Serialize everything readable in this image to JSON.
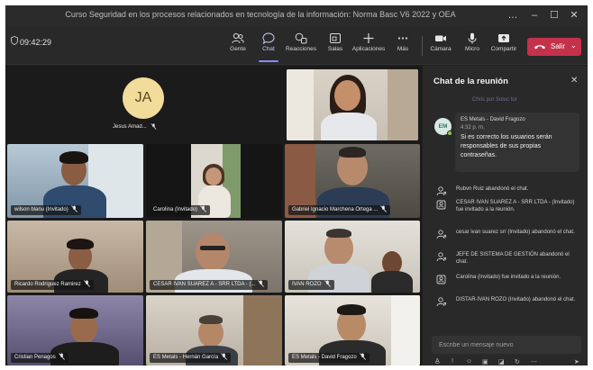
{
  "window": {
    "title": "Curso Seguridad en los procesos relacionados en tecnología de la información: Norma Basc V6 2022 y OEA",
    "controls": [
      "…",
      "–",
      "☐",
      "✕"
    ]
  },
  "toolbar": {
    "timer": "09:42:29",
    "buttons": [
      {
        "label": "Gente",
        "icon": "people-icon"
      },
      {
        "label": "Chat",
        "icon": "chat-icon"
      },
      {
        "label": "Reacciones",
        "icon": "reactions-icon"
      },
      {
        "label": "Salas",
        "icon": "rooms-icon"
      },
      {
        "label": "Aplicaciones",
        "icon": "apps-icon"
      },
      {
        "label": "Más",
        "icon": "more-icon"
      },
      {
        "label": "Cámara",
        "icon": "camera-icon"
      },
      {
        "label": "Micro",
        "icon": "mic-icon"
      },
      {
        "label": "Compartir",
        "icon": "share-icon"
      }
    ],
    "active_button": "Chat",
    "leave_label": "Salir",
    "leave_color": "#c4314b"
  },
  "participants": {
    "avatar_initials": "JA",
    "avatar_name": "Jesus Amad...",
    "tiles": [
      {
        "name": "wilson blanu (Invitado)"
      },
      {
        "name": "Carolina (Invitado)"
      },
      {
        "name": "Gabriel Ignacio Marchena Ortega ..."
      },
      {
        "name": "Ricardo Rodriguez Ramirez"
      },
      {
        "name": "CESAR IVAN SUAREZ A - SRR LTDA - (..."
      },
      {
        "name": "IVAN ROZO"
      },
      {
        "name": "Cristian Penagos"
      },
      {
        "name": "ES Metals - Hernán García"
      },
      {
        "name": "ES Metals - David Fragozo"
      }
    ]
  },
  "chat": {
    "title": "Chat de la reunión",
    "faded_text": "Chris por Soluc tor",
    "message": {
      "avatar_initials": "EM",
      "sender": "ES Metals - David Fragozo",
      "time": "4:32 p. m.",
      "text": "Si es correcto los usuarios serán responsables de sus propias contraseñas."
    },
    "events": [
      {
        "text": "Rubvn Ruiz abandonó el chat.",
        "icon": "person-leave-icon"
      },
      {
        "text": "CESAR IVAN SUAREZ A - SRR LTDA - (Invitado) fue invitado a la reunión.",
        "icon": "person-invite-icon"
      },
      {
        "text": "cesar ivan suarez srr (Invitado) abandonó el chat.",
        "icon": "person-leave-icon"
      },
      {
        "text": "JEFE DE SISTEMA DE GESTIÓN abandonó el chat.",
        "icon": "person-leave-icon"
      },
      {
        "text": "Carolina (Invitado) fue invitado a la reunión.",
        "icon": "person-invite-icon"
      },
      {
        "text": "DISTAR-IVAN ROZO (Invitado) abandonó el chat.",
        "icon": "person-leave-icon"
      }
    ],
    "compose_placeholder": "Escribe un mensaje nuevo",
    "format_icons": [
      "format-icon",
      "attach-icon",
      "emoji-icon",
      "gif-icon",
      "sticker-icon",
      "loop-icon",
      "more-icon",
      "send-icon"
    ]
  },
  "colors": {
    "accent": "#8b8cf7",
    "background": "#1f1f1f",
    "panel": "#292929"
  }
}
